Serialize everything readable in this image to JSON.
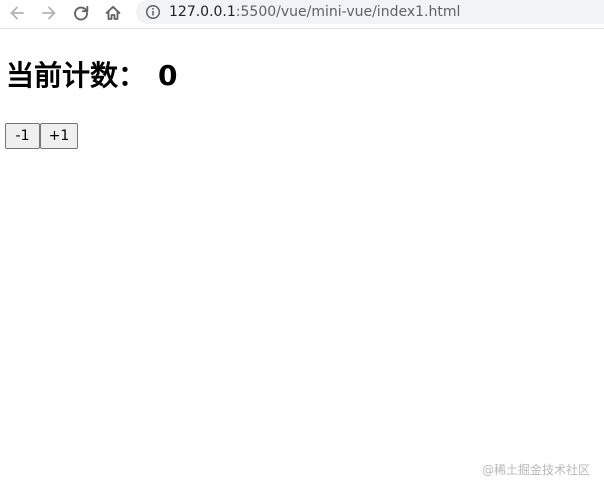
{
  "browser": {
    "url_host": "127.0.0.1",
    "url_path": ":5500/vue/mini-vue/index1.html",
    "icons": {
      "back": "arrow-left-icon",
      "forward": "arrow-right-icon",
      "reload": "reload-icon",
      "home": "home-icon",
      "info": "info-icon"
    }
  },
  "page": {
    "title_label": "当前计数：",
    "count": "0",
    "buttons": {
      "decrement": "-1",
      "increment": "+1"
    }
  },
  "watermark": "@稀土掘金技术社区"
}
